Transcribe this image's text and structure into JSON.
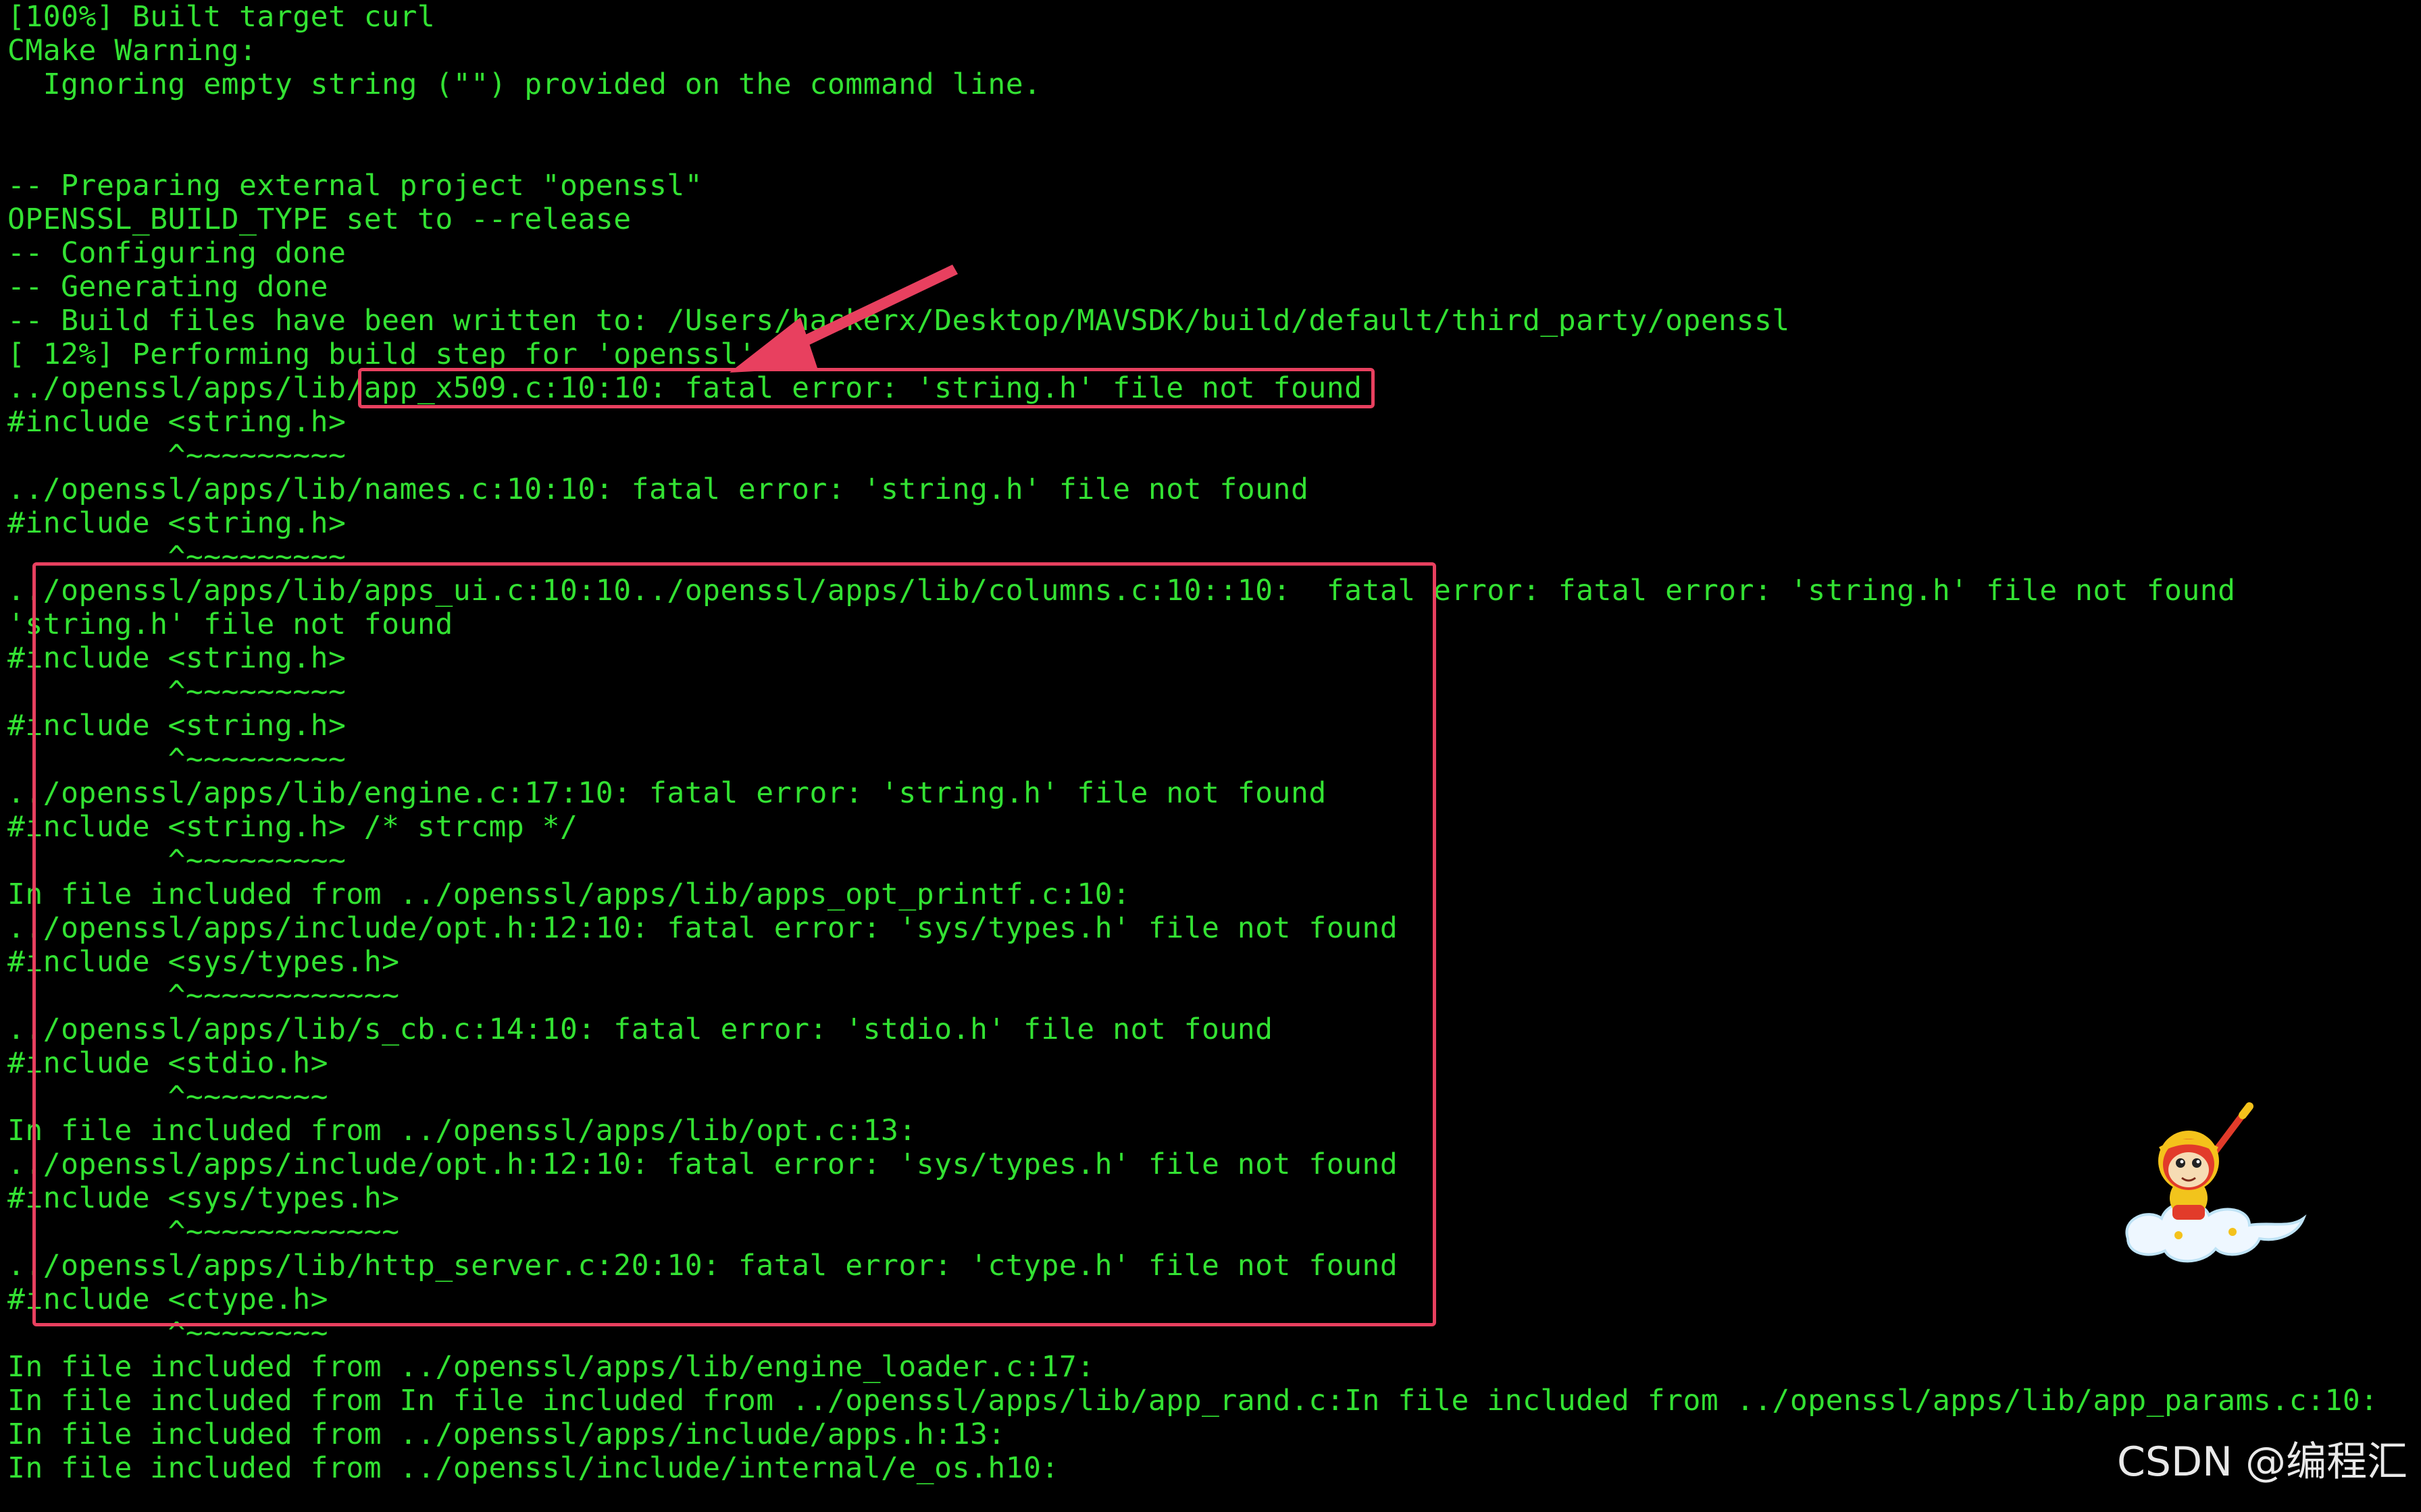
{
  "terminal": {
    "lines": [
      "[100%] Built target curl",
      "CMake Warning:",
      "  Ignoring empty string (\"\") provided on the command line.",
      "",
      "",
      "-- Preparing external project \"openssl\"",
      "OPENSSL_BUILD_TYPE set to --release",
      "-- Configuring done",
      "-- Generating done",
      "-- Build files have been written to: /Users/hackerx/Desktop/MAVSDK/build/default/third_party/openssl",
      "[ 12%] Performing build step for 'openssl'",
      "../openssl/apps/lib/app_x509.c:10:10: fatal error: 'string.h' file not found",
      "#include <string.h>",
      "         ^~~~~~~~~~",
      "../openssl/apps/lib/names.c:10:10: fatal error: 'string.h' file not found",
      "#include <string.h>",
      "         ^~~~~~~~~~",
      "../openssl/apps/lib/apps_ui.c:10:10../openssl/apps/lib/columns.c:10::10:  fatal error: fatal error: 'string.h' file not found",
      "'string.h' file not found",
      "#include <string.h>",
      "         ^~~~~~~~~~",
      "#include <string.h>",
      "         ^~~~~~~~~~",
      "../openssl/apps/lib/engine.c:17:10: fatal error: 'string.h' file not found",
      "#include <string.h> /* strcmp */",
      "         ^~~~~~~~~~",
      "In file included from ../openssl/apps/lib/apps_opt_printf.c:10:",
      "../openssl/apps/include/opt.h:12:10: fatal error: 'sys/types.h' file not found",
      "#include <sys/types.h>",
      "         ^~~~~~~~~~~~~",
      "../openssl/apps/lib/s_cb.c:14:10: fatal error: 'stdio.h' file not found",
      "#include <stdio.h>",
      "         ^~~~~~~~~",
      "In file included from ../openssl/apps/lib/opt.c:13:",
      "../openssl/apps/include/opt.h:12:10: fatal error: 'sys/types.h' file not found",
      "#include <sys/types.h>",
      "         ^~~~~~~~~~~~~",
      "../openssl/apps/lib/http_server.c:20:10: fatal error: 'ctype.h' file not found",
      "#include <ctype.h>",
      "         ^~~~~~~~~",
      "In file included from ../openssl/apps/lib/engine_loader.c:17:",
      "In file included from In file included from ../openssl/apps/lib/app_rand.c:In file included from ../openssl/apps/lib/app_params.c:10:",
      "In file included from ../openssl/apps/include/apps.h:13:",
      "In file included from ../openssl/include/internal/e_os.h10:"
    ]
  },
  "watermark": {
    "text": "CSDN @编程汇"
  },
  "sticker": {
    "icon": "monkey-king-on-cloud-icon"
  },
  "colors": {
    "background": "#000000",
    "terminal_text": "#33e233",
    "annotation": "#e8405f",
    "watermark": "#e9e9e9"
  }
}
